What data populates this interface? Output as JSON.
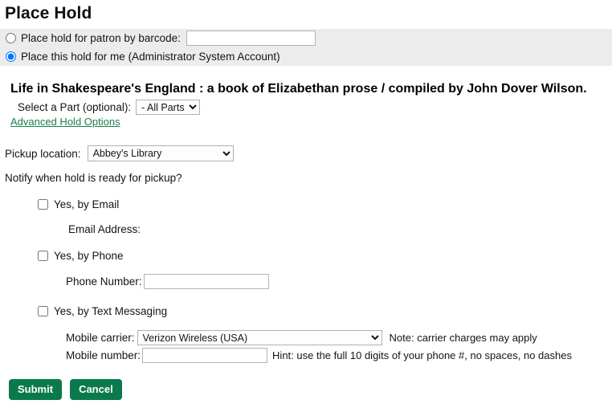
{
  "page": {
    "title": "Place Hold"
  },
  "patron_selector": {
    "barcode_option": {
      "label": "Place hold for patron by barcode:",
      "selected": false,
      "input_value": "",
      "input_placeholder": ""
    },
    "self_option": {
      "label": "Place this hold for me (Administrator System Account)",
      "selected": true
    }
  },
  "record": {
    "title": "Life in Shakespeare's England : a book of Elizabethan prose / compiled by John Dover Wilson."
  },
  "part": {
    "label": "Select a Part (optional):",
    "selected": "- All Parts -",
    "options": [
      "- All Parts -"
    ]
  },
  "advanced_link": {
    "label": "Advanced Hold Options"
  },
  "pickup": {
    "label": "Pickup location:",
    "selected": "Abbey's Library",
    "options": [
      "Abbey's Library"
    ]
  },
  "notify": {
    "question": "Notify when hold is ready for pickup?",
    "email": {
      "checkbox_label": "Yes, by Email",
      "checked": false,
      "field_label": "Email Address:",
      "field_value": ""
    },
    "phone": {
      "checkbox_label": "Yes, by Phone",
      "checked": false,
      "field_label": "Phone Number:",
      "field_value": "",
      "field_placeholder": ""
    },
    "text": {
      "checkbox_label": "Yes, by Text Messaging",
      "checked": false,
      "carrier_label": "Mobile carrier:",
      "carrier_selected": "Verizon Wireless (USA)",
      "carrier_options": [
        "Verizon Wireless (USA)"
      ],
      "carrier_note": "Note: carrier charges may apply",
      "number_label": "Mobile number:",
      "number_value": "",
      "number_placeholder": "",
      "number_hint": "Hint: use the full 10 digits of your phone #, no spaces, no dashes"
    }
  },
  "actions": {
    "submit_label": "Submit",
    "cancel_label": "Cancel"
  },
  "colors": {
    "accent_green": "#0a7a4c",
    "link_green": "#1a7d4f",
    "band_gray": "#ececec"
  }
}
